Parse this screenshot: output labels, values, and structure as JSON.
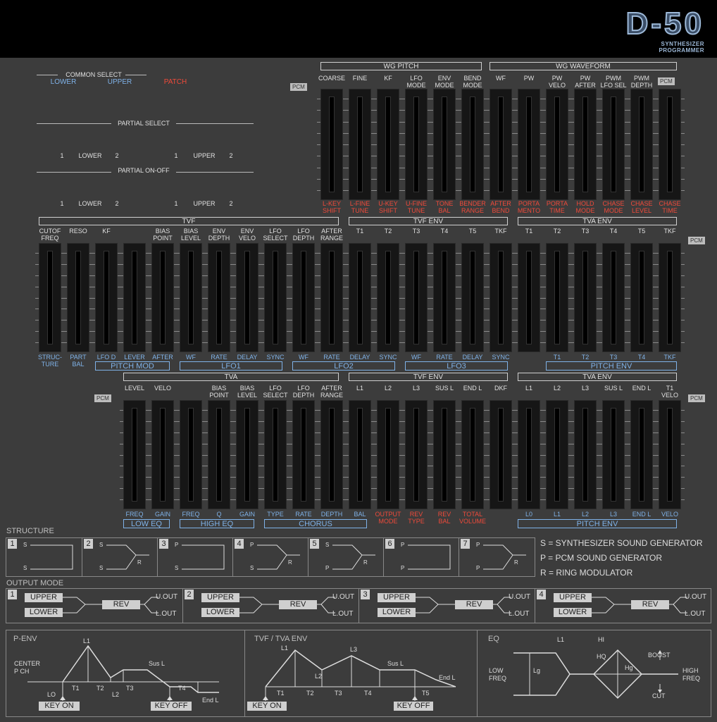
{
  "logo": {
    "title": "D-50",
    "subtitle": "SYNTHESIZER PROGRAMMER"
  },
  "pcm_label": "PCM",
  "common_select": {
    "title": "COMMON SELECT",
    "options": [
      {
        "label": "LOWER",
        "color": "#7fb2e8"
      },
      {
        "label": "UPPER",
        "color": "#7fb2e8"
      },
      {
        "label": "PATCH",
        "color": "#f04a3a"
      }
    ]
  },
  "partial_select": {
    "title": "PARTIAL SELECT",
    "lower": {
      "n1": "1",
      "label": "LOWER",
      "n2": "2"
    },
    "upper": {
      "n1": "1",
      "label": "UPPER",
      "n2": "2"
    }
  },
  "partial_onoff": {
    "title": "PARTIAL ON-OFF",
    "lower": {
      "n1": "1",
      "label": "LOWER",
      "n2": "2"
    },
    "upper": {
      "n1": "1",
      "label": "UPPER",
      "n2": "2"
    }
  },
  "row1": {
    "groups": [
      {
        "label": "WG PITCH"
      },
      {
        "label": "WG WAVEFORM"
      }
    ],
    "top": [
      "COARSE",
      "FINE",
      "KF",
      "LFO\nMODE",
      "ENV\nMODE",
      "BEND\nMODE",
      "WF",
      "PW",
      "PW\nVELO",
      "PW\nAFTER",
      "PWM\nLFO SEL",
      "PWM\nDEPTH",
      ""
    ],
    "bottom": [
      "L-KEY\nSHIFT",
      "L-FINE\nTUNE",
      "U-KEY\nSHIFT",
      "U-FINE\nTUNE",
      "TONE\nBAL",
      "BENDER\nRANGE",
      "AFTER\nBEND",
      "PORTA\nMENTO",
      "PORTA\nTIME",
      "HOLD\nMODE",
      "CHASE\nMODE",
      "CHASE\nLEVEL",
      "CHASE\nTIME"
    ]
  },
  "row2": {
    "groups": [
      {
        "label": "TVF"
      },
      {
        "label": "TVF ENV"
      },
      {
        "label": "TVA ENV"
      }
    ],
    "top": [
      "CUTOF\nFREQ",
      "RESO",
      "KF",
      "",
      "BIAS\nPOINT",
      "BIAS\nLEVEL",
      "ENV\nDEPTH",
      "ENV\nVELO",
      "LFO\nSELECT",
      "LFO\nDEPTH",
      "AFTER\nRANGE",
      "T1",
      "T2",
      "T3",
      "T4",
      "T5",
      "TKF",
      "T1",
      "T2",
      "T3",
      "T4",
      "T5",
      "TKF"
    ],
    "bottom": [
      "STRUC-\nTURE",
      "PART\nBAL",
      "LFO D",
      "LEVER",
      "AFTER",
      "WF",
      "RATE",
      "DELAY",
      "SYNC",
      "WF",
      "RATE",
      "DELAY",
      "SYNC",
      "WF",
      "RATE",
      "DELAY",
      "SYNC",
      "",
      "T1",
      "T2",
      "T3",
      "T4",
      "TKF"
    ],
    "subgroups": [
      {
        "label": "PITCH MOD"
      },
      {
        "label": "LFO1"
      },
      {
        "label": "LFO2"
      },
      {
        "label": "LFO3"
      },
      {
        "label": "PITCH ENV"
      }
    ]
  },
  "row3": {
    "groups": [
      {
        "label": "TVA"
      },
      {
        "label": "TVF ENV"
      },
      {
        "label": "TVA ENV"
      }
    ],
    "top": [
      "LEVEL",
      "VELO",
      "",
      "BIAS\nPOINT",
      "BIAS\nLEVEL",
      "LFO\nSELECT",
      "LFO\nDEPTH",
      "AFTER\nRANGE",
      "L1",
      "L2",
      "L3",
      "SUS L",
      "END L",
      "DKF",
      "L1",
      "L2",
      "L3",
      "SUS L",
      "END L",
      "T1\nVELO"
    ],
    "bottom": [
      "FREQ",
      "GAIN",
      "FREQ",
      "Q",
      "GAIN",
      "TYPE",
      "RATE",
      "DEPTH",
      "BAL",
      "OUTPUT\nMODE",
      "REV\nTYPE",
      "REV\nBAL",
      "TOTAL\nVOLUME",
      "",
      "L0",
      "L1",
      "L2",
      "L3",
      "END L",
      "VELO"
    ],
    "subgroups": [
      {
        "label": "LOW EQ"
      },
      {
        "label": "HIGH EQ"
      },
      {
        "label": "CHORUS"
      },
      {
        "label": "PITCH ENV"
      }
    ]
  },
  "structure": {
    "title": "STRUCTURE",
    "items": [
      {
        "n": "1",
        "a": "S",
        "b": "S",
        "r": ""
      },
      {
        "n": "2",
        "a": "S",
        "b": "S",
        "r": "R"
      },
      {
        "n": "3",
        "a": "P",
        "b": "S",
        "r": ""
      },
      {
        "n": "4",
        "a": "P",
        "b": "S",
        "r": "R"
      },
      {
        "n": "5",
        "a": "S",
        "b": "P",
        "r": "R"
      },
      {
        "n": "6",
        "a": "P",
        "b": "P",
        "r": ""
      },
      {
        "n": "7",
        "a": "P",
        "b": "P",
        "r": "R"
      }
    ],
    "legend": [
      "S = SYNTHESIZER SOUND GENERATOR",
      "P = PCM SOUND GENERATOR",
      "R = RING MODULATOR"
    ]
  },
  "output_mode": {
    "title": "OUTPUT MODE",
    "items": [
      {
        "n": "1",
        "upper": "UPPER",
        "lower": "LOWER",
        "rev": "REV",
        "uout": "U.OUT",
        "lout": "L.OUT"
      },
      {
        "n": "2",
        "upper": "UPPER",
        "lower": "LOWER",
        "rev": "REV",
        "uout": "U.OUT",
        "lout": "L.OUT"
      },
      {
        "n": "3",
        "upper": "UPPER",
        "lower": "LOWER",
        "rev": "REV",
        "uout": "U.OUT",
        "lout": "L.OUT"
      },
      {
        "n": "4",
        "upper": "UPPER",
        "lower": "LOWER",
        "rev": "REV",
        "uout": "U.OUT",
        "lout": "L.OUT"
      }
    ]
  },
  "penv": {
    "title": "P-ENV",
    "center1": "CENTER",
    "center2": "P CH",
    "l1": "L1",
    "susl": "Sus L",
    "lo": "LO",
    "t1": "T1",
    "t2": "T2",
    "l2": "L2",
    "t3": "T3",
    "t4": "T4",
    "endl": "End L",
    "keyon": "KEY ON",
    "keyoff": "KEY OFF"
  },
  "tvfenv": {
    "title": "TVF / TVA ENV",
    "l1": "L1",
    "l3": "L3",
    "susl": "Sus L",
    "l2": "L2",
    "endl": "End L",
    "t1": "T1",
    "t2": "T2",
    "t3": "T3",
    "t4": "T4",
    "t5": "T5",
    "keyon": "KEY ON",
    "keyoff": "KEY OFF"
  },
  "eq": {
    "title": "EQ",
    "l1": "L1",
    "hi": "HI",
    "hq": "HQ",
    "hg": "Hg",
    "lg": "Lg",
    "boost": "BOOST",
    "cut": "CUT",
    "low": "LOW",
    "freq_low": "FREQ",
    "high": "HIGH",
    "freq_high": "FREQ"
  },
  "colors": {
    "panel": "#3c3c3c",
    "blue": "#7fb2e8",
    "red": "#f04a3a",
    "logo": "#9db9d8"
  }
}
